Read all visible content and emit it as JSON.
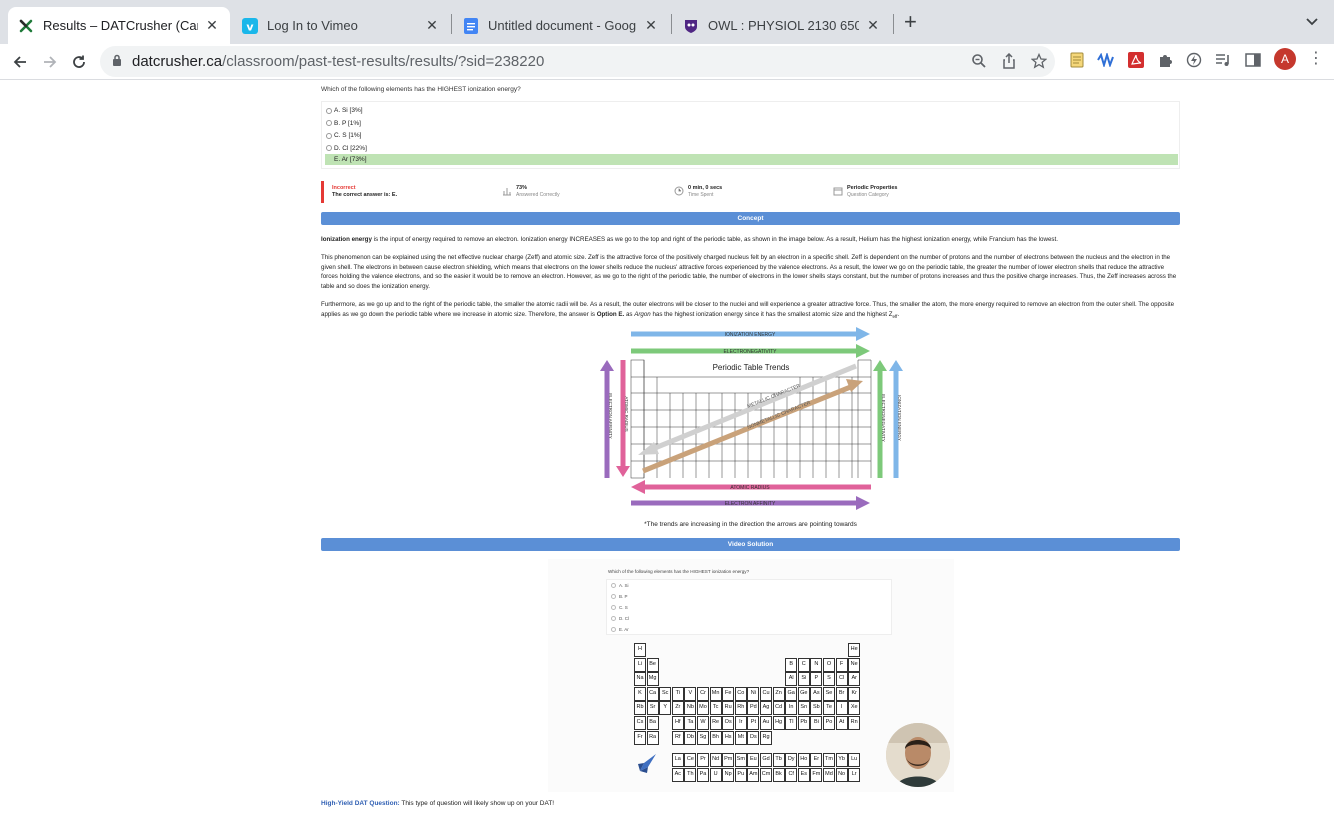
{
  "browser": {
    "tabs": [
      {
        "title": "Results – DATCrusher (Canadia",
        "icon": "datcrusher-icon",
        "active": true
      },
      {
        "title": "Log In to Vimeo",
        "icon": "vimeo-icon",
        "active": false
      },
      {
        "title": "Untitled document - Google Do",
        "icon": "google-docs-icon",
        "active": false
      },
      {
        "title": "OWL : PHYSIOL 2130 650 SU2",
        "icon": "owl-icon",
        "active": false
      }
    ],
    "url_domain": "datcrusher.ca",
    "url_path": "/classroom/past-test-results/results/?sid=238220",
    "avatar_letter": "A"
  },
  "question": {
    "text": "Which of the following elements has the HIGHEST ionization energy?",
    "options": [
      "A. Si [3%]",
      "B. P [1%]",
      "C. S [1%]",
      "D. Cl [22%]",
      "E. Ar [73%]"
    ],
    "correct_index": 4
  },
  "result": {
    "status": "Incorrect",
    "correct_answer": "The correct answer is: E.",
    "percent": "73%",
    "percent_label": "Answered Correctly",
    "time": "0 min, 0 secs",
    "time_label": "Time Spent",
    "category": "Periodic Properties",
    "category_label": "Question Category"
  },
  "concept": {
    "header": "Concept",
    "p1_bold": "Ionization energy",
    "p1_rest": " is the input of energy required to remove an electron. Ionization energy INCREASES as we go to the top and right of the periodic table, as shown in the image below. As a result, Helium has the highest ionization energy, while Francium has the lowest.",
    "p2": "This phenomenon can be explained using the net effective nuclear charge (Zeff) and atomic size. Zeff is the attractive force of the positively charged nucleus felt by an electron in a specific shell. Zeff is dependent on the number of protons and the number of electrons between the nucleus and the electron in the given shell. The electrons in between cause electron shielding, which means that electrons on the lower shells reduce the nucleus' attractive forces experienced by the valence electrons. As a result, the lower we go on the periodic table, the greater the number of lower electron shells that reduce the attractive forces holding the valence electrons, and so the easier it would be to remove an electron. However, as we go to the right of the periodic table, the number of electrons in the lower shells stays constant, but the number of protons increases and thus the positive charge increases. Thus, the Zeff increases across the table and so does the ionization energy.",
    "p3_a": "Furthermore, as we go up and to the right of the periodic table, the smaller the atomic radii will be. As a result, the outer electrons will be closer to the nuclei and will experience a greater attractive force. Thus, the smaller the atom, the more energy required to remove an electron from the outer shell. The opposite applies as we go down the periodic table where we increase in atomic size. Therefore, the answer is ",
    "p3_bold": "Option E.",
    "p3_b": " as ",
    "p3_italic": "Argon",
    "p3_c": " has the highest ionization energy since it has the smallest atomic size and the highest Z",
    "p3_sub": "eff",
    "p3_end": "."
  },
  "trends": {
    "title": "Periodic Table Trends",
    "top1": "IONIZATION ENERGY",
    "top2": "ELECTRONEGATIVITY",
    "bottom1": "ATOMIC RADIUS",
    "bottom2": "ELECTRON AFFINITY",
    "left1": "ELECTRON AFFINITY",
    "left2": "ATOMIC RADIUS",
    "right1": "ELECTRONEGATIVITY",
    "right2": "IONIZATION ENERGY",
    "diag1": "METALLIC CHARACTER",
    "diag2": "NONMETALLIC CHARACTER",
    "caption": "*The trends are increasing in the direction the arrows are pointing towards",
    "colors": {
      "blue": "#7fb6e8",
      "green": "#7dc97a",
      "pink": "#e0629a",
      "purple": "#9a6bbd",
      "grey": "#d0d0d0",
      "tan": "#c9a27a"
    }
  },
  "video": {
    "header": "Video Solution",
    "question": "Which of the following elements has the HIGHEST ionization energy?",
    "options": [
      "A. Si",
      "B. P",
      "C. S",
      "D. Cl",
      "E. Ar"
    ],
    "elements": {
      "r1": [
        "H",
        "He"
      ],
      "r2": [
        "Li",
        "Be",
        "B",
        "C",
        "N",
        "O",
        "F",
        "Ne"
      ],
      "r3": [
        "Na",
        "Mg",
        "Al",
        "Si",
        "P",
        "S",
        "Cl",
        "Ar"
      ],
      "r4": [
        "K",
        "Ca",
        "Sc",
        "Ti",
        "V",
        "Cr",
        "Mn",
        "Fe",
        "Co",
        "Ni",
        "Cu",
        "Zn",
        "Ga",
        "Ge",
        "As",
        "Se",
        "Br",
        "Kr"
      ],
      "r5": [
        "Rb",
        "Sr",
        "Y",
        "Zr",
        "Nb",
        "Mo",
        "Tc",
        "Ru",
        "Rh",
        "Pd",
        "Ag",
        "Cd",
        "In",
        "Sn",
        "Sb",
        "Te",
        "I",
        "Xe"
      ],
      "r6": [
        "Cs",
        "Ba",
        "",
        "Hf",
        "Ta",
        "W",
        "Re",
        "Os",
        "Ir",
        "Pt",
        "Au",
        "Hg",
        "Tl",
        "Pb",
        "Bi",
        "Po",
        "At",
        "Rn"
      ],
      "r7": [
        "Fr",
        "Ra",
        "",
        "Rf",
        "Db",
        "Sg",
        "Bh",
        "Hs",
        "Mt",
        "Ds",
        "Rg"
      ],
      "lan": [
        "La",
        "Ce",
        "Pr",
        "Nd",
        "Pm",
        "Sm",
        "Eu",
        "Gd",
        "Tb",
        "Dy",
        "Ho",
        "Er",
        "Tm",
        "Yb",
        "Lu"
      ],
      "act": [
        "Ac",
        "Th",
        "Pa",
        "U",
        "Np",
        "Pu",
        "Am",
        "Cm",
        "Bk",
        "Cf",
        "Es",
        "Fm",
        "Md",
        "No",
        "Lr"
      ]
    }
  },
  "high_yield": {
    "label": "High-Yield DAT Question:",
    "text": " This type of question will likely show up on your DAT!"
  }
}
